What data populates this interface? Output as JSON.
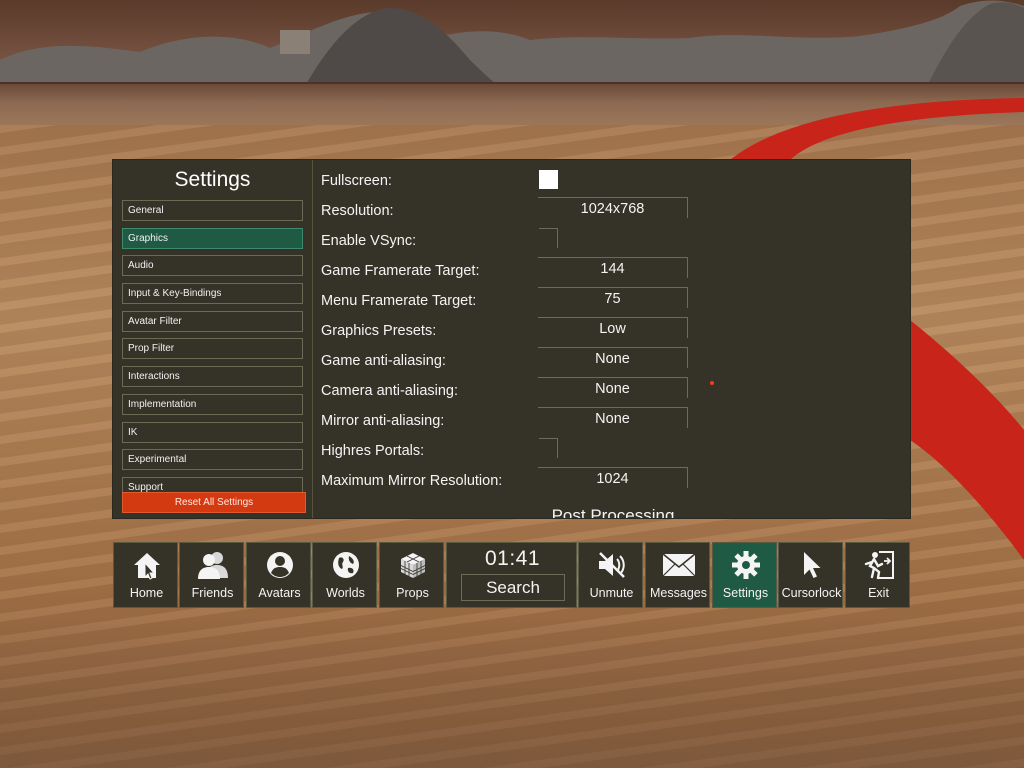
{
  "settings": {
    "title": "Settings",
    "nav": [
      {
        "label": "General",
        "active": false
      },
      {
        "label": "Graphics",
        "active": true
      },
      {
        "label": "Audio",
        "active": false
      },
      {
        "label": "Input & Key-Bindings",
        "active": false
      },
      {
        "label": "Avatar Filter",
        "active": false
      },
      {
        "label": "Prop Filter",
        "active": false
      },
      {
        "label": "Interactions",
        "active": false
      },
      {
        "label": "Implementation",
        "active": false
      },
      {
        "label": "IK",
        "active": false
      },
      {
        "label": "Experimental",
        "active": false
      },
      {
        "label": "Support",
        "active": false
      }
    ],
    "reset_label": "Reset All Settings",
    "graphics": {
      "fullscreen": {
        "label": "Fullscreen:",
        "checked": true
      },
      "resolution": {
        "label": "Resolution:",
        "value": "1024x768"
      },
      "vsync": {
        "label": "Enable VSync:",
        "checked": false
      },
      "game_framerate": {
        "label": "Game Framerate Target:",
        "value": "144"
      },
      "menu_framerate": {
        "label": "Menu Framerate Target:",
        "value": "75"
      },
      "presets": {
        "label": "Graphics Presets:",
        "value": "Low"
      },
      "game_aa": {
        "label": "Game anti-aliasing:",
        "value": "None"
      },
      "camera_aa": {
        "label": "Camera anti-aliasing:",
        "value": "None"
      },
      "mirror_aa": {
        "label": "Mirror anti-aliasing:",
        "value": "None"
      },
      "highres_portals": {
        "label": "Highres Portals:",
        "checked": false
      },
      "mirror_res": {
        "label": "Maximum Mirror Resolution:",
        "value": "1024"
      }
    },
    "section_heading": "Post Processing"
  },
  "bottombar": {
    "home": {
      "label": "Home",
      "icon": "house-icon"
    },
    "friends": {
      "label": "Friends",
      "icon": "people-icon"
    },
    "avatars": {
      "label": "Avatars",
      "icon": "user-circle-icon"
    },
    "worlds": {
      "label": "Worlds",
      "icon": "globe-icon"
    },
    "props": {
      "label": "Props",
      "icon": "cube-icon"
    },
    "clock": "01:41",
    "search": "Search",
    "unmute": {
      "label": "Unmute",
      "icon": "speaker-muted-icon"
    },
    "messages": {
      "label": "Messages",
      "icon": "envelope-icon"
    },
    "settings": {
      "label": "Settings",
      "icon": "gear-icon",
      "active": true
    },
    "cursorlock": {
      "label": "Cursorlock",
      "icon": "cursor-icon"
    },
    "exit": {
      "label": "Exit",
      "icon": "exit-door-icon"
    }
  },
  "colors": {
    "panel_bg": "#353227",
    "active_green": "#1f5a45",
    "reset_red": "#d33a12",
    "track_red": "#c8241a"
  }
}
